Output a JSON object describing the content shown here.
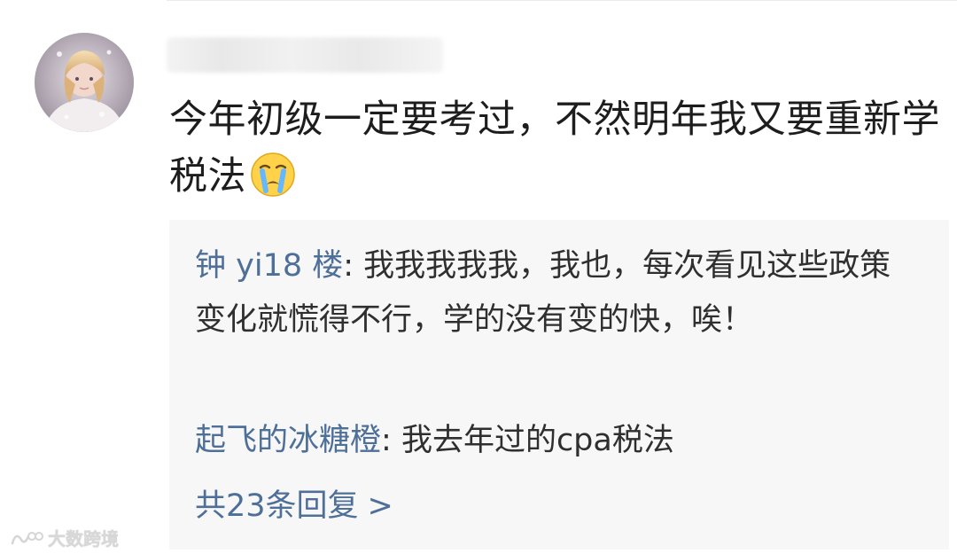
{
  "comment": {
    "text": "今年初级一定要考过，不然明年我又要重新学税法",
    "emoji": "crying-face"
  },
  "replies": [
    {
      "author": "钟 yi18 楼",
      "separator": ": ",
      "text": "我我我我我，我也，每次看见这些政策变化就慌得不行，学的没有变的快，唉！"
    },
    {
      "author": "起飞的冰糖橙",
      "separator": ": ",
      "text": "我去年过的cpa税法"
    }
  ],
  "more_replies": {
    "label": "共23条回复",
    "arrow": ">"
  },
  "watermark": {
    "text": "大数跨境"
  },
  "colors": {
    "body_text": "#1d1d1d",
    "reply_text": "#2f2f2f",
    "link": "#4d6f98",
    "reply_background": "#f7f7f7"
  }
}
